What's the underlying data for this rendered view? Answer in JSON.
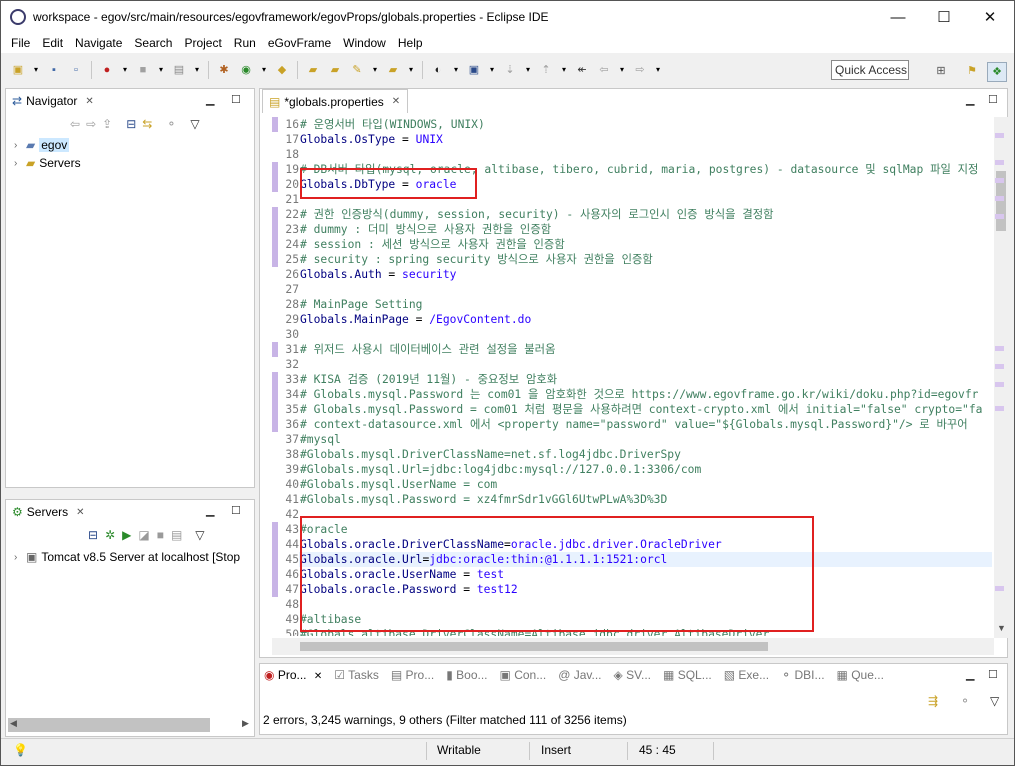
{
  "window": {
    "title": "workspace - egov/src/main/resources/egovframework/egovProps/globals.properties - Eclipse IDE",
    "controls": {
      "minimize": "—",
      "maximize": "☐",
      "close": "✕"
    }
  },
  "menu": [
    "File",
    "Edit",
    "Navigate",
    "Search",
    "Project",
    "Run",
    "eGovFrame",
    "Window",
    "Help"
  ],
  "quick_access": "Quick Access",
  "navigator": {
    "title": "Navigator",
    "items": [
      {
        "label": "egov",
        "icon": "project-folder-icon"
      },
      {
        "label": "Servers",
        "icon": "folder-icon"
      }
    ]
  },
  "servers": {
    "title": "Servers",
    "items": [
      {
        "label": "Tomcat v8.5 Server at localhost  [Stop"
      }
    ]
  },
  "editor": {
    "tab": "*globals.properties",
    "lines": [
      {
        "n": "16",
        "t": "# 운영서버 타입(WINDOWS, UNIX)",
        "k": "cmt",
        "m": true
      },
      {
        "n": "17",
        "t": "Globals.OsType = UNIX",
        "k": "prop"
      },
      {
        "n": "18",
        "t": "",
        "k": "plain"
      },
      {
        "n": "19",
        "t": "# DB서버 타입(mysql, oracle, altibase, tibero, cubrid, maria, postgres) - datasource 및 sqlMap 파일 지정",
        "k": "cmt",
        "m": true
      },
      {
        "n": "20",
        "t": "Globals.DbType = oracle",
        "k": "prop",
        "m": true
      },
      {
        "n": "21",
        "t": "",
        "k": "plain"
      },
      {
        "n": "22",
        "t": "# 권한 인증방식(dummy, session, security) - 사용자의 로그인시 인증 방식을 결정함",
        "k": "cmt",
        "m": true
      },
      {
        "n": "23",
        "t": "# dummy : 더미 방식으로 사용자 권한을 인증함",
        "k": "cmt",
        "m": true
      },
      {
        "n": "24",
        "t": "# session : 세션 방식으로 사용자 권한을 인증함",
        "k": "cmt",
        "m": true
      },
      {
        "n": "25",
        "t": "# security : spring security 방식으로 사용자 권한을 인증함",
        "k": "cmt",
        "m": true
      },
      {
        "n": "26",
        "t": "Globals.Auth = security",
        "k": "prop"
      },
      {
        "n": "27",
        "t": "",
        "k": "plain"
      },
      {
        "n": "28",
        "t": "# MainPage Setting",
        "k": "cmt"
      },
      {
        "n": "29",
        "t": "Globals.MainPage  = /EgovContent.do",
        "k": "prop"
      },
      {
        "n": "30",
        "t": "",
        "k": "plain"
      },
      {
        "n": "31",
        "t": "# 위저드 사용시 데이터베이스 관련 설정을 불러옴",
        "k": "cmt",
        "m": true
      },
      {
        "n": "32",
        "t": "",
        "k": "plain"
      },
      {
        "n": "33",
        "t": "# KISA 검증 (2019년 11월) - 중요정보 암호화",
        "k": "cmt",
        "m": true
      },
      {
        "n": "34",
        "t": "# Globals.mysql.Password 는 com01 을 암호화한 것으로 https://www.egovframe.go.kr/wiki/doku.php?id=egovfr",
        "k": "cmt",
        "m": true
      },
      {
        "n": "35",
        "t": "# Globals.mysql.Password = com01 처럼 평문을 사용하려면 context-crypto.xml 에서 initial=\"false\" crypto=\"fa",
        "k": "cmt",
        "m": true
      },
      {
        "n": "36",
        "t": "# context-datasource.xml 에서 <property name=\"password\" value=\"${Globals.mysql.Password}\"/> 로 바꾸어",
        "k": "cmt",
        "m": true
      },
      {
        "n": "37",
        "t": "#mysql",
        "k": "cmt"
      },
      {
        "n": "38",
        "t": "#Globals.mysql.DriverClassName=net.sf.log4jdbc.DriverSpy",
        "k": "cmt"
      },
      {
        "n": "39",
        "t": "#Globals.mysql.Url=jdbc:log4jdbc:mysql://127.0.0.1:3306/com",
        "k": "cmt"
      },
      {
        "n": "40",
        "t": "#Globals.mysql.UserName = com",
        "k": "cmt"
      },
      {
        "n": "41",
        "t": "#Globals.mysql.Password = xz4fmrSdr1vGGl6UtwPLwA%3D%3D",
        "k": "cmt"
      },
      {
        "n": "42",
        "t": "",
        "k": "plain"
      },
      {
        "n": "43",
        "t": "#oracle",
        "k": "cmt",
        "m": true
      },
      {
        "n": "44",
        "t": "Globals.oracle.DriverClassName=oracle.jdbc.driver.OracleDriver",
        "k": "prop",
        "m": true
      },
      {
        "n": "45",
        "t": "Globals.oracle.Url=jdbc:oracle:thin:@1.1.1.1:1521:orcl",
        "k": "prop",
        "m": true,
        "hl": true
      },
      {
        "n": "46",
        "t": "Globals.oracle.UserName = test",
        "k": "prop",
        "m": true
      },
      {
        "n": "47",
        "t": "Globals.oracle.Password = test12",
        "k": "prop",
        "m": true
      },
      {
        "n": "48",
        "t": "",
        "k": "plain"
      },
      {
        "n": "49",
        "t": "#altibase",
        "k": "cmt"
      },
      {
        "n": "50",
        "t": "#Globals.altibase.DriverClassName=Altibase.jdbc.driver.AltibaseDriver",
        "k": "cmt"
      }
    ]
  },
  "problems": {
    "tabs": [
      "Pro...",
      "Tasks",
      "Pro...",
      "Boo...",
      "Con...",
      "@ Jav...",
      "SV...",
      "SQL...",
      "Exe...",
      "DBI...",
      "Que..."
    ],
    "summary": "2 errors, 3,245 warnings, 9 others (Filter matched 111 of 3256 items)"
  },
  "status": {
    "writable": "Writable",
    "insert": "Insert",
    "position": "45 : 45"
  }
}
